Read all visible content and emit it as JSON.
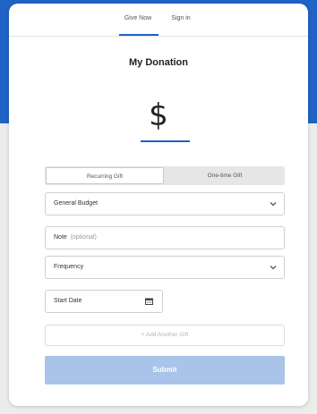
{
  "tabs": {
    "give_now": "Give Now",
    "sign_in": "Sign in"
  },
  "form": {
    "title": "My Donation",
    "currency_symbol": "$",
    "gift_type": {
      "recurring": "Recurring Gift",
      "one_time": "One-time Gift",
      "selected": "Recurring Gift"
    },
    "fund": "General Budget",
    "note_label": "Note",
    "note_placeholder": "(optional)",
    "frequency": "Frequency",
    "start_date": "Start Date",
    "add_gift": "+ Add Another Gift",
    "submit": "Submit"
  },
  "icons": {
    "dropdown": "chevron-down-icon",
    "calendar": "calendar-icon"
  },
  "colors": {
    "brand_blue": "#1f63c4",
    "submit_disabled": "#a9c4e8",
    "background": "#ececed"
  }
}
